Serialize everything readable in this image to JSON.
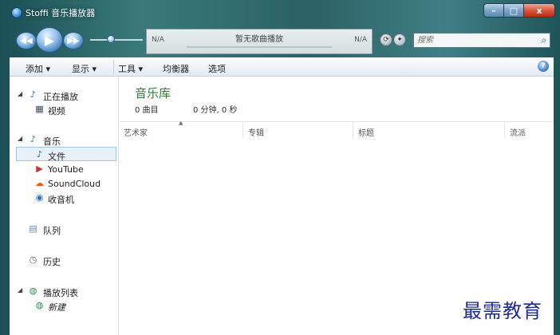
{
  "window": {
    "title": "Stoffi 音乐播放器",
    "min_icon": "minimize-icon",
    "max_icon": "maximize-icon",
    "close_icon": "close-icon",
    "min_glyph": "–",
    "max_glyph": "□",
    "close_glyph": "x"
  },
  "player": {
    "prev_glyph": "◀◀",
    "play_glyph": "▶",
    "next_glyph": "▶▶",
    "volume_level": 0.4,
    "elapsed": "N/A",
    "remaining": "N/A",
    "now_playing": "暂无歌曲播放",
    "repeat_glyph": "⟳",
    "shuffle_glyph": "✦",
    "search_placeholder": "搜索",
    "search_glyph": "⌕"
  },
  "menu": {
    "items": [
      "添加 ▾",
      "显示 ▾",
      "工具 ▾",
      "均衡器",
      "选项"
    ],
    "help_glyph": "?"
  },
  "sidebar": {
    "now_playing": "正在播放",
    "video": "视频",
    "music": "音乐",
    "files": "文件",
    "youtube": "YouTube",
    "soundcloud": "SoundCloud",
    "radio": "收音机",
    "queue": "队列",
    "history": "历史",
    "playlists": "播放列表",
    "new": "新建",
    "collapse_glyph": "◢"
  },
  "library": {
    "title": "音乐库",
    "count": "0 曲目",
    "duration": "0 分钟, 0 秒",
    "columns": [
      "艺术家",
      "专辑",
      "标题",
      "流派"
    ]
  },
  "watermark": "最需教育",
  "colors": {
    "accent": "#2f7d32",
    "selection": "#e6f1fb",
    "frame": "#2b6264"
  }
}
